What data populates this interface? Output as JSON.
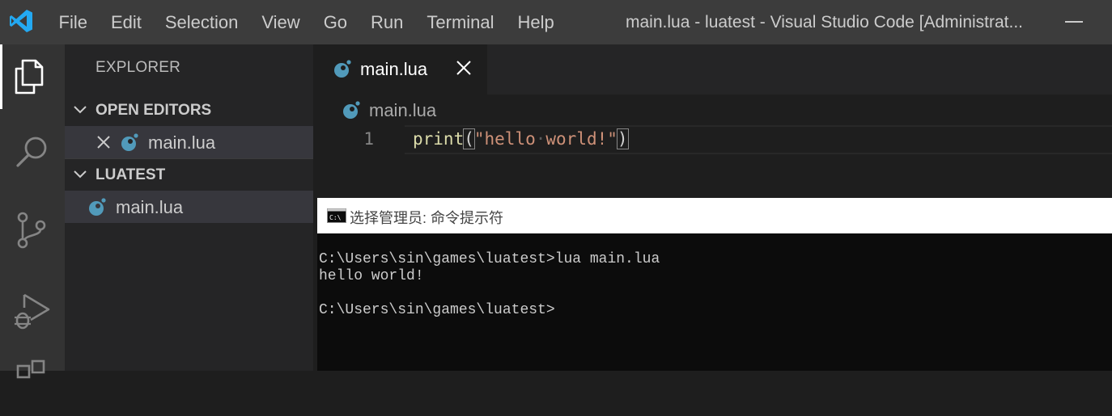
{
  "titlebar": {
    "menu": [
      "File",
      "Edit",
      "Selection",
      "View",
      "Go",
      "Run",
      "Terminal",
      "Help"
    ],
    "window_title": "main.lua - luatest - Visual Studio Code [Administrat..."
  },
  "activitybar": {
    "icons": [
      "explorer-icon",
      "search-icon",
      "source-control-icon",
      "run-debug-icon",
      "extensions-icon"
    ]
  },
  "sidebar": {
    "title": "EXPLORER",
    "open_editors": {
      "header": "OPEN EDITORS",
      "items": [
        {
          "name": "main.lua"
        }
      ]
    },
    "folder": {
      "header": "LUATEST",
      "items": [
        {
          "name": "main.lua"
        }
      ]
    }
  },
  "editor": {
    "tab": {
      "name": "main.lua"
    },
    "breadcrumb": "main.lua",
    "line_number": "1",
    "code": {
      "fn": "print",
      "open_paren": "(",
      "string_parts": [
        "\"hello",
        "·",
        "world!\""
      ],
      "close_paren": ")"
    }
  },
  "console": {
    "title": "选择管理员: 命令提示符",
    "lines": [
      "C:\\Users\\sin\\games\\luatest>lua main.lua",
      "hello world!",
      "",
      "C:\\Users\\sin\\games\\luatest>"
    ]
  },
  "colors": {
    "titlebar": "#3c3c3c",
    "activitybar": "#333333",
    "sidebar": "#252526",
    "editor": "#1e1e1e",
    "lua_icon": "#519aba",
    "vscode_logo": "#23a9f2"
  }
}
